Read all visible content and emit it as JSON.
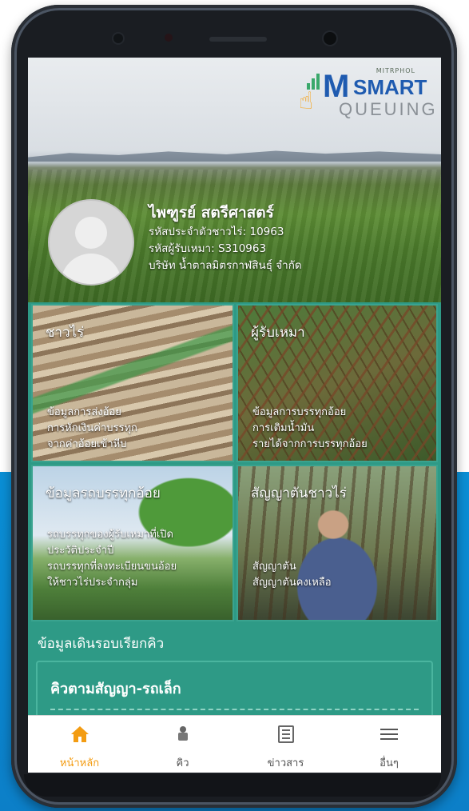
{
  "logo": {
    "brand_small": "MITRPHOL",
    "brand_m": "M",
    "brand_smart": "SMART",
    "brand_queuing": "QUEUING"
  },
  "profile": {
    "name": "ไพฑูรย์  สตรีศาสตร์",
    "farmer_code": "รหัสประจำตัวชาวไร่: 10963",
    "contractor_code": "รหัสผู้รับเหมา: S310963",
    "company": "บริษัท น้ำตาลมิตรกาฬสินธุ์ จำกัด"
  },
  "tiles": [
    {
      "title": "ชาวไร่",
      "lines": [
        "ข้อมูลการส่งอ้อย",
        "การหักเงินค่าบรรทุก",
        "จากค่าอ้อยเข้าหีบ"
      ]
    },
    {
      "title": "ผู้รับเหมา",
      "lines": [
        "ข้อมูลการบรรทุกอ้อย",
        "การเติมน้ำมัน",
        "รายได้จากการบรรทุกอ้อย"
      ]
    },
    {
      "title": "ข้อมูลรถบรรทุกอ้อย",
      "lines": [
        "รถบรรทุกของผู้รับเหมาที่เปิด",
        "ประวัติประจำปี",
        "รถบรรทุกที่ลงทะเบียนขนอ้อย",
        "ให้ชาวไร่ประจำกลุ่ม"
      ]
    },
    {
      "title": "สัญญาตันชาวไร่",
      "lines": [
        "สัญญาตัน",
        "สัญญาตันคงเหลือ"
      ]
    }
  ],
  "queue_section": {
    "title": "ข้อมูลเดินรอบเรียกคิว",
    "card_title": "คิวตามสัญญา-รถเล็ก"
  },
  "tabbar": {
    "items": [
      {
        "label": "หน้าหลัก",
        "icon": "home-icon",
        "active": true
      },
      {
        "label": "คิว",
        "icon": "queue-icon",
        "active": false
      },
      {
        "label": "ข่าวสาร",
        "icon": "news-icon",
        "active": false
      },
      {
        "label": "อื่นๆ",
        "icon": "menu-icon",
        "active": false
      }
    ]
  },
  "colors": {
    "primary": "#2e9a86",
    "accent": "#f39c12",
    "background_blue": "#0a8fd6"
  }
}
